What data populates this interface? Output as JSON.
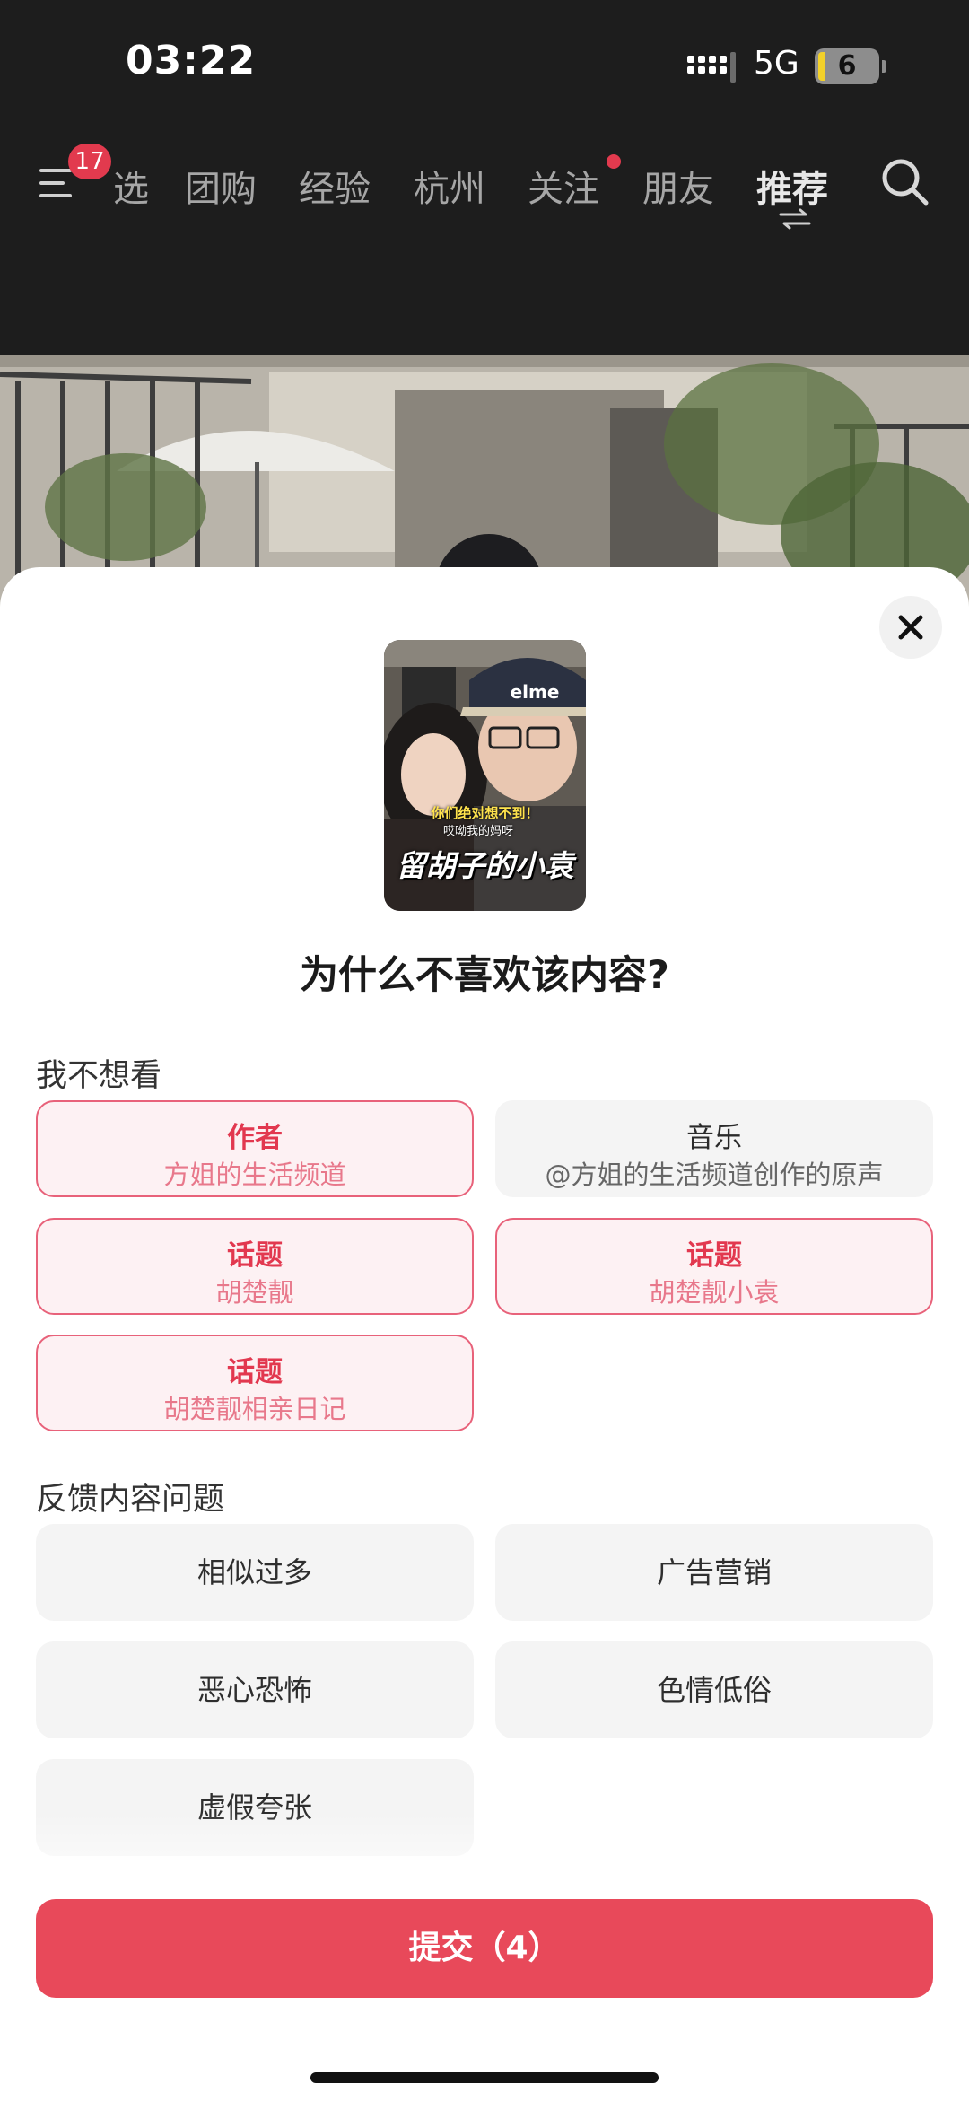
{
  "status_bar": {
    "time": "03:22",
    "network": "5G",
    "battery": "6"
  },
  "nav": {
    "menu_badge": "17",
    "tabs": [
      "选",
      "团购",
      "经验",
      "杭州",
      "关注",
      "朋友",
      "推荐"
    ],
    "active_tab": "推荐",
    "icons": [
      "menu-icon",
      "switch-icon",
      "search-icon"
    ]
  },
  "sheet": {
    "thumbnail": {
      "caption_top": "你们绝对想不到！",
      "caption_mid": "哎呦我的妈呀",
      "caption_main": "留胡子的小袁",
      "cap_text": "elme"
    },
    "question": "为什么不喜欢该内容?",
    "section1_title": "我不想看",
    "options": [
      {
        "type": "作者",
        "value": "方姐的生活频道",
        "selected": true
      },
      {
        "type": "音乐",
        "value": "@方姐的生活频道创作的原声",
        "selected": false
      },
      {
        "type": "话题",
        "value": "胡楚靓",
        "selected": true
      },
      {
        "type": "话题",
        "value": "胡楚靓小袁",
        "selected": true
      },
      {
        "type": "话题",
        "value": "胡楚靓相亲日记",
        "selected": true
      }
    ],
    "section2_title": "反馈内容问题",
    "feedback": [
      "相似过多",
      "广告营销",
      "恶心恐怖",
      "色情低俗",
      "虚假夸张"
    ],
    "submit_label": "提交（4）"
  },
  "colors": {
    "accent": "#e8495a",
    "selected_bg": "#fdf1f3",
    "selected_border": "#e8627a",
    "chip_bg": "#f4f4f4"
  }
}
